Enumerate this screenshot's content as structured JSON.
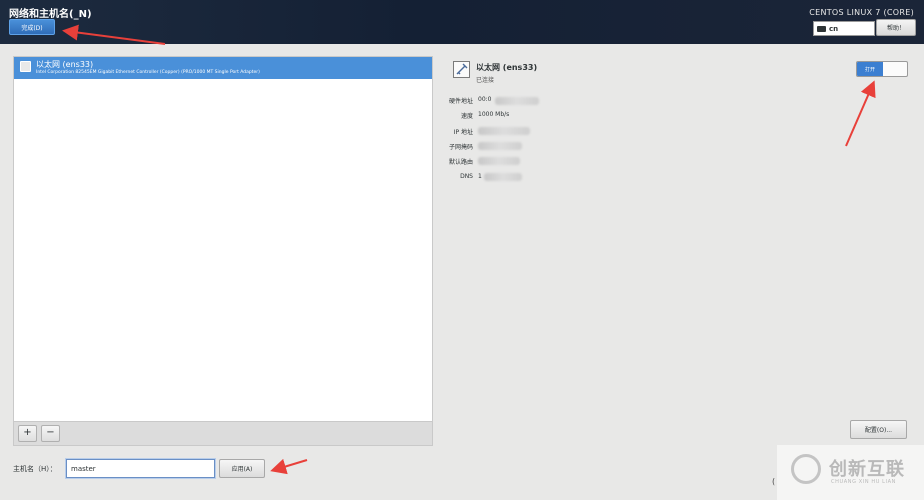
{
  "header": {
    "title": "网络和主机名(_N)",
    "done_label": "完成(D)",
    "product": "CENTOS LINUX 7 (CORE)",
    "keyboard_layout": "cn",
    "help_label": "帮助！"
  },
  "device_list": {
    "items": [
      {
        "name": "以太网 (ens33)",
        "description": "Intel Corporation 82545EM Gigabit Ethernet Controller (Copper) (PRO/1000 MT Single Port Adapter)",
        "selected": true
      }
    ],
    "add_label": "+",
    "remove_label": "−"
  },
  "hostname": {
    "label": "主机名（H）：",
    "value": "master",
    "apply_label": "应用(A)"
  },
  "details": {
    "name": "以太网 (ens33)",
    "status": "已连接",
    "rows": [
      {
        "label": "硬件地址",
        "value": "00:0"
      },
      {
        "label": "速度",
        "value": "1000 Mb/s"
      },
      {
        "label": "IP 地址",
        "value": ""
      },
      {
        "label": "子网掩码",
        "value": ""
      },
      {
        "label": "默认路由",
        "value": ""
      },
      {
        "label": "DNS",
        "value": "1"
      }
    ],
    "toggle_label": "打开",
    "toggle_on": true,
    "configure_label": "配置(O)..."
  },
  "watermark": {
    "text": "创新互联",
    "subtext": "CHUANG XIN HU LIAN"
  },
  "colors": {
    "header_bg": "#142034",
    "accent": "#4a90d9",
    "annotation_arrow": "#e8403a"
  }
}
